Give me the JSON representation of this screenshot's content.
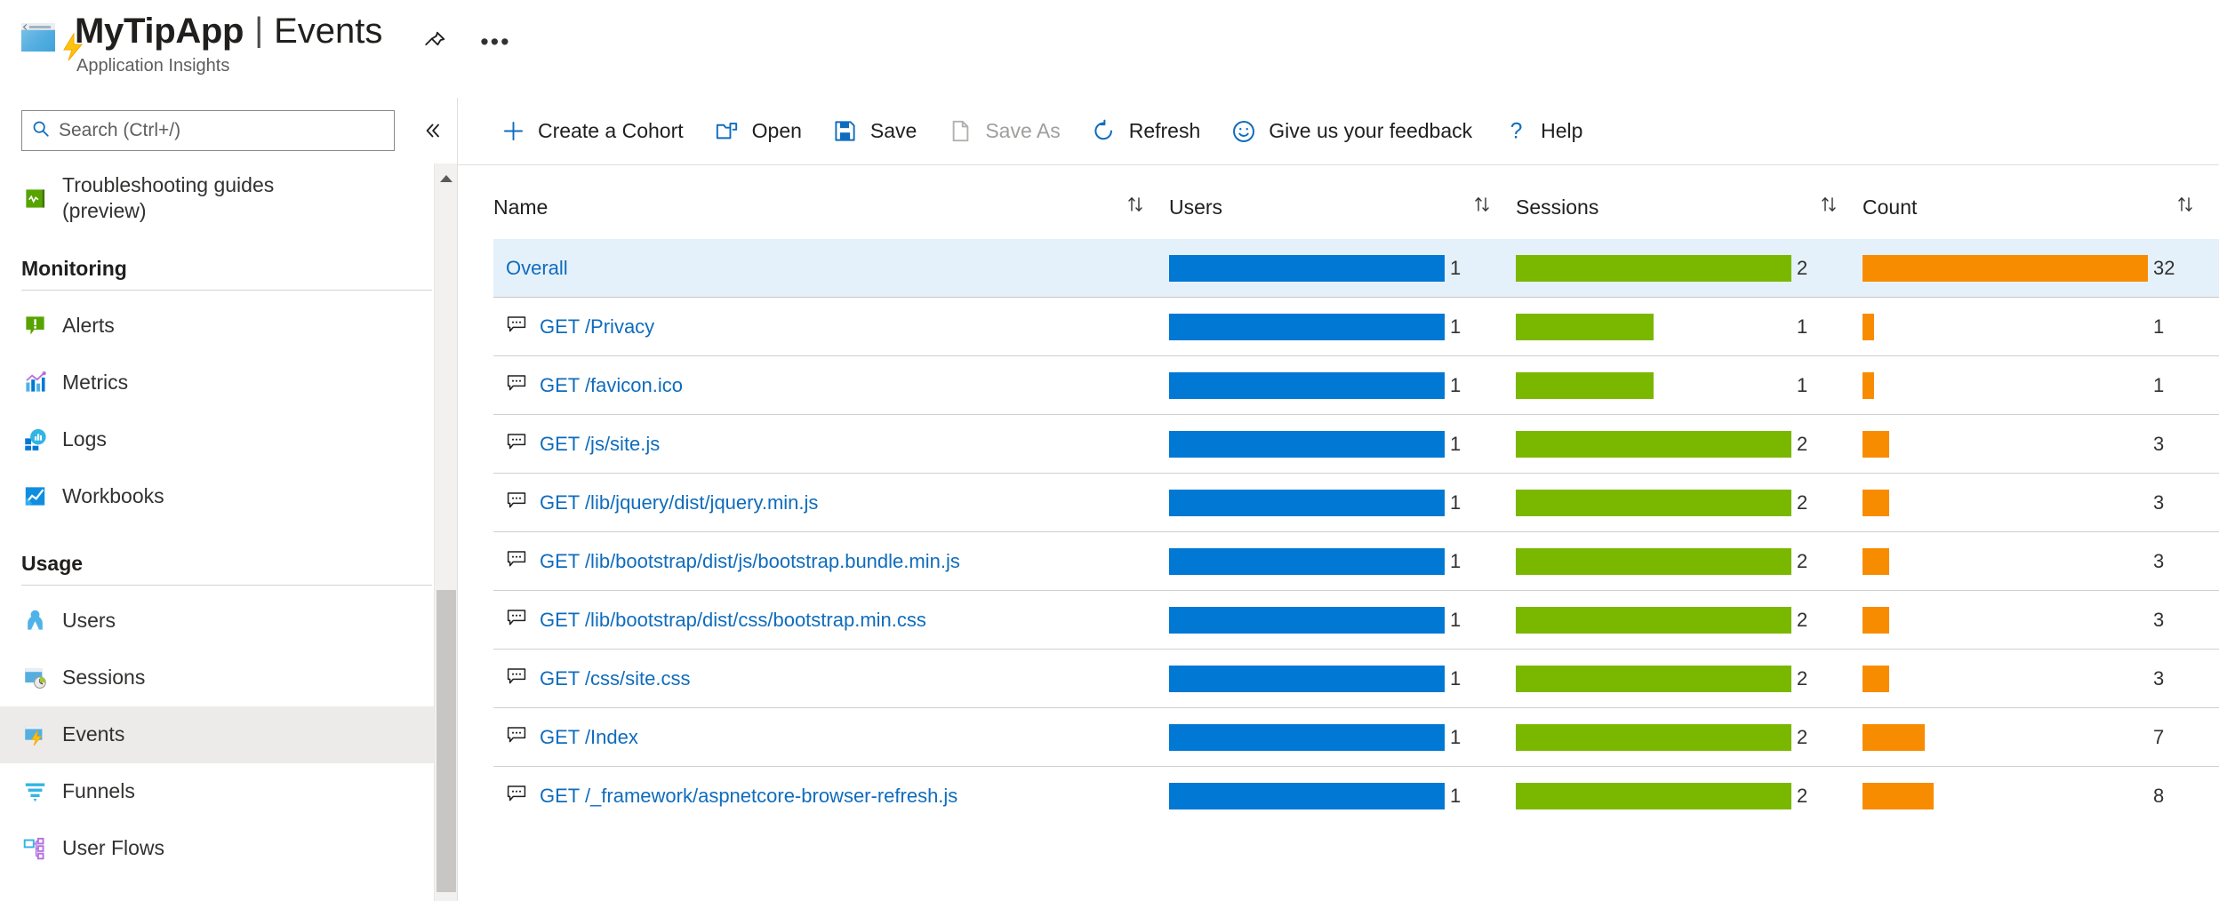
{
  "header": {
    "app_icon": "app-insights-events-icon",
    "title": "MyTipApp",
    "separator": "|",
    "page": "Events",
    "subtitle": "Application Insights",
    "pin_icon": "pin-icon",
    "more_icon": "ellipsis-icon"
  },
  "sidebar": {
    "search": {
      "placeholder": "Search (Ctrl+/)",
      "value": "",
      "icon": "search-icon"
    },
    "collapse_icon": "chevron-double-left-icon",
    "items": [
      {
        "label": "Troubleshooting guides (preview)",
        "icon": "troubleshooting-book-icon",
        "type": "item",
        "selected": false
      },
      {
        "label": "Monitoring",
        "type": "group"
      },
      {
        "label": "Alerts",
        "icon": "alerts-icon",
        "type": "item",
        "selected": false
      },
      {
        "label": "Metrics",
        "icon": "metrics-icon",
        "type": "item",
        "selected": false
      },
      {
        "label": "Logs",
        "icon": "logs-icon",
        "type": "item",
        "selected": false
      },
      {
        "label": "Workbooks",
        "icon": "workbooks-icon",
        "type": "item",
        "selected": false
      },
      {
        "label": "Usage",
        "type": "group"
      },
      {
        "label": "Users",
        "icon": "users-icon",
        "type": "item",
        "selected": false
      },
      {
        "label": "Sessions",
        "icon": "sessions-icon",
        "type": "item",
        "selected": false
      },
      {
        "label": "Events",
        "icon": "events-icon",
        "type": "item",
        "selected": true
      },
      {
        "label": "Funnels",
        "icon": "funnels-icon",
        "type": "item",
        "selected": false
      },
      {
        "label": "User Flows",
        "icon": "user-flows-icon",
        "type": "item",
        "selected": false
      }
    ]
  },
  "toolbar": {
    "items": [
      {
        "label": "Create a Cohort",
        "icon": "plus-icon",
        "disabled": false
      },
      {
        "label": "Open",
        "icon": "open-folder-icon",
        "disabled": false
      },
      {
        "label": "Save",
        "icon": "save-disk-icon",
        "disabled": false
      },
      {
        "label": "Save As",
        "icon": "save-as-page-icon",
        "disabled": true
      },
      {
        "label": "Refresh",
        "icon": "refresh-icon",
        "disabled": false
      },
      {
        "label": "Give us your feedback",
        "icon": "smiley-face-icon",
        "disabled": false
      },
      {
        "label": "Help",
        "icon": "question-mark-icon",
        "disabled": false
      }
    ]
  },
  "chart_data": {
    "type": "table",
    "title": "Events",
    "columns": [
      "Name",
      "Users",
      "Sessions",
      "Count"
    ],
    "sort_icon": "sort-updown-icon",
    "row_icon": "page-view-bubble-icon",
    "colors": {
      "users_bar": "#0078D4",
      "sessions_bar": "#7AB800",
      "count_bar": "#F88C00",
      "highlight_row": "#E5F1FA",
      "link": "#0F6CBD"
    },
    "max": {
      "users": 1,
      "sessions": 2,
      "count": 32
    },
    "rows": [
      {
        "name": "Overall",
        "has_icon": false,
        "highlight": true,
        "users": 1,
        "sessions": 2,
        "count": 32
      },
      {
        "name": "GET /Privacy",
        "has_icon": true,
        "highlight": false,
        "users": 1,
        "sessions": 1,
        "count": 1
      },
      {
        "name": "GET /favicon.ico",
        "has_icon": true,
        "highlight": false,
        "users": 1,
        "sessions": 1,
        "count": 1
      },
      {
        "name": "GET /js/site.js",
        "has_icon": true,
        "highlight": false,
        "users": 1,
        "sessions": 2,
        "count": 3
      },
      {
        "name": "GET /lib/jquery/dist/jquery.min.js",
        "has_icon": true,
        "highlight": false,
        "users": 1,
        "sessions": 2,
        "count": 3
      },
      {
        "name": "GET /lib/bootstrap/dist/js/bootstrap.bundle.min.js",
        "has_icon": true,
        "highlight": false,
        "users": 1,
        "sessions": 2,
        "count": 3
      },
      {
        "name": "GET /lib/bootstrap/dist/css/bootstrap.min.css",
        "has_icon": true,
        "highlight": false,
        "users": 1,
        "sessions": 2,
        "count": 3
      },
      {
        "name": "GET /css/site.css",
        "has_icon": true,
        "highlight": false,
        "users": 1,
        "sessions": 2,
        "count": 3
      },
      {
        "name": "GET /Index",
        "has_icon": true,
        "highlight": false,
        "users": 1,
        "sessions": 2,
        "count": 7
      },
      {
        "name": "GET /_framework/aspnetcore-browser-refresh.js",
        "has_icon": true,
        "highlight": false,
        "users": 1,
        "sessions": 2,
        "count": 8
      }
    ]
  }
}
